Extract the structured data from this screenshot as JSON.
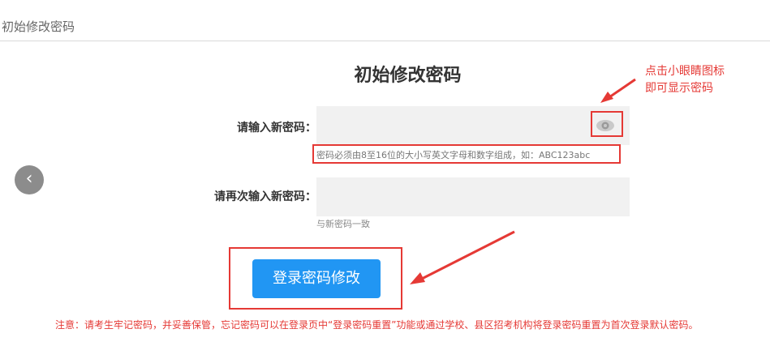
{
  "header": {
    "breadcrumb": "初始修改密码"
  },
  "form": {
    "title": "初始修改密码",
    "new_password": {
      "label": "请输入新密码：",
      "value": "",
      "hint": "密码必须由8至16位的大小写英文字母和数字组成，如：ABC123abc"
    },
    "confirm_password": {
      "label": "请再次输入新密码：",
      "value": "",
      "hint": "与新密码一致"
    },
    "submit_label": "登录密码修改"
  },
  "annotation": {
    "line1": "点击小眼睛图标",
    "line2": "即可显示密码"
  },
  "nav": {
    "prev_glyph": "‹"
  },
  "note": "注意：请考生牢记密码，并妥善保管，忘记密码可以在登录页中“登录密码重置”功能或通过学校、县区招考机构将登录密码重置为首次登录默认密码。",
  "colors": {
    "accent": "#2196f3",
    "annotation_red": "#e53935",
    "input_bg": "#f1f1f1"
  },
  "icons": {
    "eye": "eye-icon",
    "prev": "chevron-left-icon"
  }
}
